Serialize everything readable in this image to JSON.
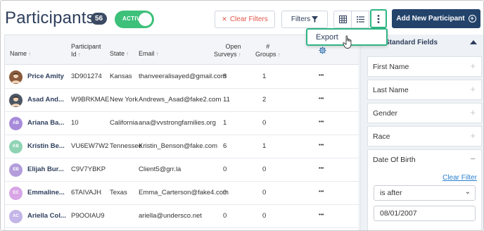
{
  "header": {
    "title": "Participants",
    "count": "56",
    "toggle_label": "ACTIVE",
    "clear_filters": "Clear Filters",
    "filters": "Filters",
    "add_participant": "Add New Participant"
  },
  "menu": {
    "export": "Export"
  },
  "table": {
    "columns": {
      "name": "Name",
      "participant_id_1": "Participant",
      "participant_id_2": "Id",
      "state": "State",
      "email": "Email",
      "open_surveys_1": "Open",
      "open_surveys_2": "Surveys",
      "groups_1": "#",
      "groups_2": "Groups"
    },
    "rows": [
      {
        "name": "Price Amity",
        "id": "3D901274",
        "state": "Kansas",
        "email": "thanveeralisayed@gmail.com",
        "open": "8",
        "groups": "1",
        "avatar": "",
        "avatar_color": "#8a5a3c"
      },
      {
        "name": "Asad And...",
        "id": "W9BRKMAE",
        "state": "New York",
        "email": "Andrews_Asad@fake2.com",
        "open": "11",
        "groups": "2",
        "avatar": "",
        "avatar_color": "#4b5563"
      },
      {
        "name": "Ariana Ba...",
        "id": "10",
        "state": "California",
        "email": "ana@vvstrongfamilies.org",
        "open": "1",
        "groups": "0",
        "avatar": "AB",
        "avatar_color": "#a78bda"
      },
      {
        "name": "Kristin Be...",
        "id": "VU6EW7W2",
        "state": "Tennessee",
        "email": "Kristin_Benson@fake.com",
        "open": "6",
        "groups": "1",
        "avatar": "KB",
        "avatar_color": "#8fd3b4"
      },
      {
        "name": "Elijah Bur...",
        "id": "C9V7YBKP",
        "state": "",
        "email": "Client5@grr.la",
        "open": "0",
        "groups": "0",
        "avatar": "EB",
        "avatar_color": "#b39ddb"
      },
      {
        "name": "Emmaline...",
        "id": "6TAIVAJH",
        "state": "Texas",
        "email": "Emma_Carterson@fake4.com",
        "open": "0",
        "groups": "0",
        "avatar": "EC",
        "avatar_color": "#d8a5e6"
      },
      {
        "name": "Ariella Col...",
        "id": "P9OOIAU9",
        "state": "",
        "email": "ariella@undersco.net",
        "open": "0",
        "groups": "0",
        "avatar": "AC",
        "avatar_color": "#c4b5e8"
      }
    ]
  },
  "panel": {
    "title": "Standard Fields",
    "fields": [
      "First Name",
      "Last Name",
      "Gender",
      "Race"
    ],
    "dob_label": "Date Of Birth",
    "clear_filter": "Clear Filter",
    "operator": "is after",
    "date_value": "08/01/2007"
  },
  "colors": {
    "title": "#2d3e5c",
    "toggle": "#3cc07a",
    "highlight": "#2fb584",
    "add_button": "#23436b",
    "clear_filters": "#e2574c",
    "link": "#2a7fd1"
  }
}
